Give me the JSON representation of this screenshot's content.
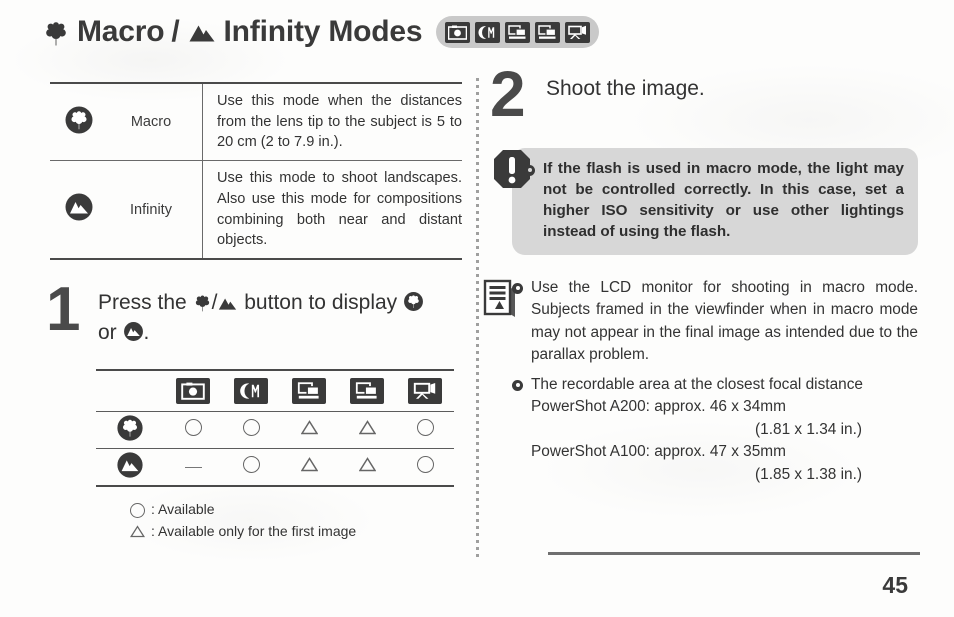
{
  "header": {
    "title_part1": "Macro",
    "separator": "/",
    "title_part2": "Infinity Modes",
    "macro_icon": "flower-icon",
    "infinity_icon": "mountain-icon",
    "mode_chips": [
      {
        "name": "still-image-mode-icon",
        "label": "Still Image"
      },
      {
        "name": "manual-mode-icon",
        "label": "Manual"
      },
      {
        "name": "stitch-assist-mode-icon",
        "label": "Stitch Assist"
      },
      {
        "name": "stitch-assist-2-mode-icon",
        "label": "Stitch Assist 2"
      },
      {
        "name": "movie-mode-icon",
        "label": "Movie"
      }
    ]
  },
  "description_table": {
    "rows": [
      {
        "symbol": "macro-flower-symbol",
        "name": "Macro",
        "description": "Use this mode when the distances from the lens tip to the subject is 5 to 20 cm (2 to 7.9 in.)."
      },
      {
        "symbol": "infinity-mountain-symbol",
        "name": "Infinity",
        "description": "Use this mode to shoot landscapes. Also use this mode for compositions combining both near and distant objects."
      }
    ]
  },
  "step1": {
    "number": "1",
    "text_before": "Press the",
    "text_middle": "button to display",
    "text_or": "or",
    "text_end": "."
  },
  "matrix": {
    "column_icons": [
      "still-image-mode-icon",
      "manual-mode-icon",
      "stitch-assist-mode-icon",
      "stitch-assist-2-mode-icon",
      "movie-mode-icon"
    ],
    "rows": [
      {
        "symbol": "macro-flower-symbol",
        "marks": [
          "circle",
          "circle",
          "triangle",
          "triangle",
          "circle"
        ]
      },
      {
        "symbol": "infinity-mountain-symbol",
        "marks": [
          "dash",
          "circle",
          "triangle",
          "triangle",
          "circle"
        ]
      }
    ],
    "legend": [
      {
        "mark": "circle",
        "text": ": Available"
      },
      {
        "mark": "triangle",
        "text": ": Available only for the first image"
      }
    ]
  },
  "step2": {
    "number": "2",
    "text": "Shoot the image."
  },
  "caution": {
    "icon": "warning-exclamation-icon",
    "items": [
      "If the flash is used in macro mode, the light may not be controlled correctly. In this case, set a higher ISO sensitivity or use other lightings instead of using the flash."
    ]
  },
  "notes": {
    "icon": "memo-note-icon",
    "items": [
      {
        "text": "Use the LCD monitor for shooting in macro mode. Subjects framed in the viewfinder when in macro mode may not appear in the final image as intended due to the parallax problem.",
        "sub_lines": []
      },
      {
        "text": "The recordable area at the closest focal distance",
        "sub_lines": [
          {
            "text": "PowerShot A200: approx. 46 x 34mm",
            "align": "left"
          },
          {
            "text": "(1.81 x 1.34 in.)",
            "align": "right"
          },
          {
            "text": "PowerShot A100: approx. 47 x 35mm",
            "align": "left"
          },
          {
            "text": "(1.85 x 1.38 in.)",
            "align": "right"
          }
        ]
      }
    ]
  },
  "footer": {
    "page_number": "45"
  },
  "colors": {
    "ink": "#3a3a3a",
    "chip_bg": "#3a3a3a",
    "chip_group_bg": "#c9c9c9",
    "caution_bg": "#d7d7d7",
    "paper": "#fdfdfc"
  }
}
